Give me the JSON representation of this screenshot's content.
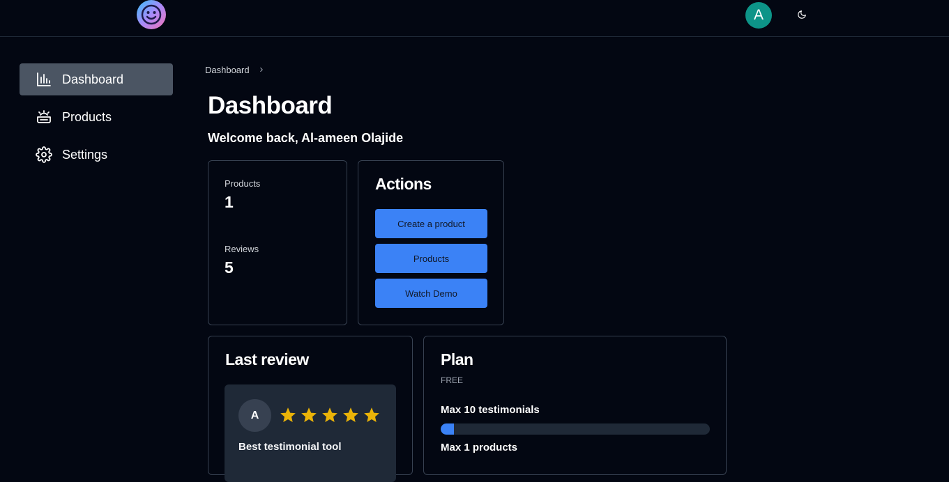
{
  "header": {
    "logo_icon": "smiley-logo-icon",
    "avatar_initial": "A",
    "avatar_color": "#0d9488",
    "theme_icon": "moon-icon"
  },
  "sidebar": {
    "items": [
      {
        "label": "Dashboard",
        "icon": "bar-chart-icon",
        "active": true
      },
      {
        "label": "Products",
        "icon": "product-box-icon",
        "active": false
      },
      {
        "label": "Settings",
        "icon": "gear-icon",
        "active": false
      }
    ]
  },
  "breadcrumb": {
    "items": [
      "Dashboard"
    ]
  },
  "page": {
    "title": "Dashboard",
    "welcome": "Welcome back, Al-ameen Olajide"
  },
  "stats": {
    "products_label": "Products",
    "products_value": "1",
    "reviews_label": "Reviews",
    "reviews_value": "5"
  },
  "actions": {
    "title": "Actions",
    "buttons": [
      "Create a product",
      "Products",
      "Watch Demo"
    ]
  },
  "last_review": {
    "title": "Last review",
    "reviewer_initial": "A",
    "rating": 5,
    "text": "Best testimonial tool"
  },
  "plan": {
    "title": "Plan",
    "tier": "FREE",
    "testimonials_limit": "Max 10 testimonials",
    "testimonials_progress": 0.05,
    "products_limit": "Max 1 products"
  },
  "colors": {
    "background": "#030712",
    "accent": "#3b82f6",
    "star": "#eab308",
    "card_border": "#374151"
  }
}
